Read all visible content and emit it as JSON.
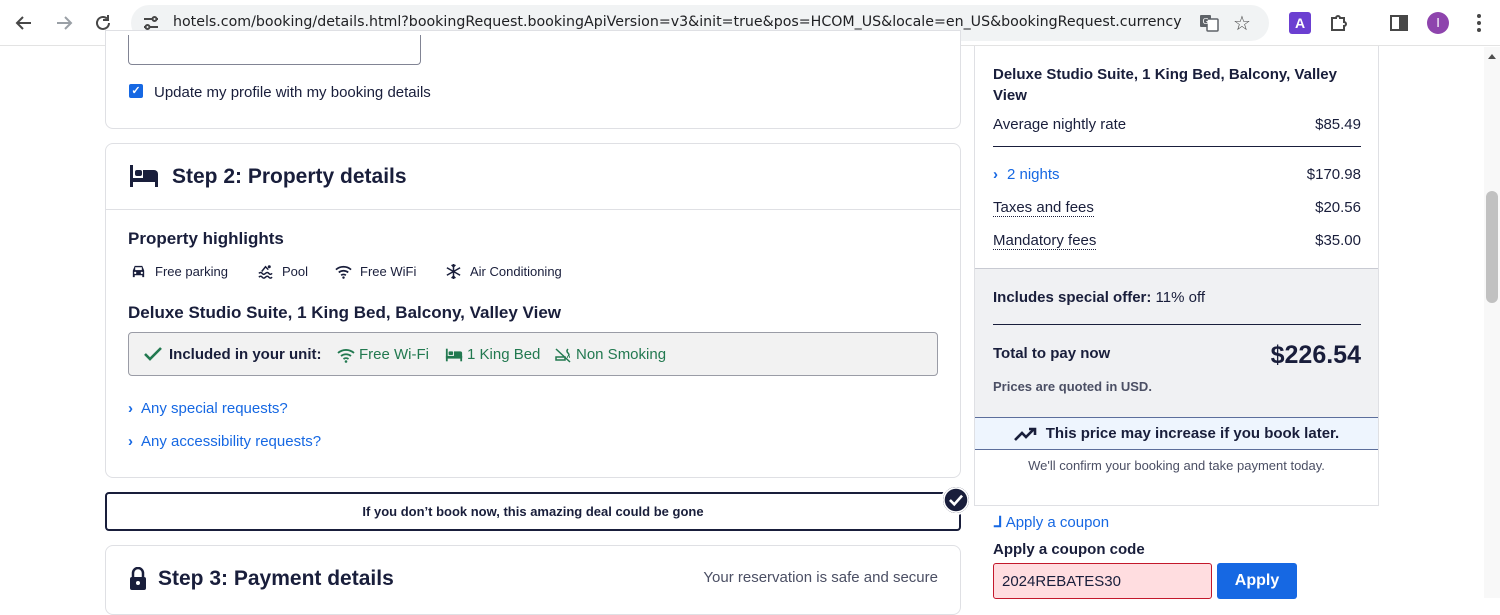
{
  "browser": {
    "url": "hotels.com/booking/details.html?bookingRequest.bookingApiVersion=v3&init=true&pos=HCOM_US&locale=en_US&bookingRequest.currency=US...",
    "profile_initial": "I",
    "extension_letter": "A"
  },
  "step1": {
    "update_profile_label": "Update my profile with my booking details",
    "update_profile_checked": true
  },
  "step2": {
    "title": "Step 2: Property details",
    "highlights_title": "Property highlights",
    "amenities": [
      {
        "label": "Free parking",
        "icon": "car-icon"
      },
      {
        "label": "Pool",
        "icon": "pool-icon"
      },
      {
        "label": "Free WiFi",
        "icon": "wifi-icon"
      },
      {
        "label": "Air Conditioning",
        "icon": "snowflake-icon"
      }
    ],
    "room_name": "Deluxe Studio Suite, 1 King Bed, Balcony, Valley View",
    "included_label": "Included in your unit:",
    "included": [
      {
        "label": "Free Wi-Fi",
        "icon": "wifi-icon"
      },
      {
        "label": "1 King Bed",
        "icon": "bed-icon"
      },
      {
        "label": "Non Smoking",
        "icon": "no-smoking-icon"
      }
    ],
    "special_requests": "Any special requests?",
    "accessibility_requests": "Any accessibility requests?"
  },
  "deal_banner": "If you don’t book now, this amazing deal could be gone",
  "step3": {
    "title": "Step 3: Payment details",
    "secure_note": "Your reservation is safe and secure"
  },
  "summary": {
    "room_name": "Deluxe Studio Suite, 1 King Bed, Balcony, Valley View",
    "avg_rate_label": "Average nightly rate",
    "avg_rate_value": "$85.49",
    "nights_label": "2 nights",
    "nights_value": "$170.98",
    "taxes_label": "Taxes and fees",
    "taxes_value": "$20.56",
    "mandatory_label": "Mandatory fees",
    "mandatory_value": "$35.00",
    "offer_label": "Includes special offer:",
    "offer_value": " 11% off",
    "total_label": "Total to pay now",
    "total_value": "$226.54",
    "currency_note": "Prices are quoted in USD.",
    "price_warning": "This price may increase if you book later.",
    "confirm_note": "We'll confirm your booking and take payment today."
  },
  "coupon": {
    "link": "Apply a coupon",
    "label": "Apply a coupon code",
    "value": "2024REBATES30",
    "apply": "Apply"
  },
  "colors": {
    "brand_blue": "#1668e3",
    "included_green": "#227950",
    "text_dark": "#191e3b",
    "error_bg": "#ffdde0"
  }
}
